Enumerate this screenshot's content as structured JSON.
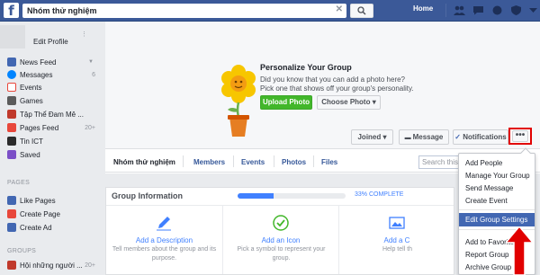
{
  "topbar": {
    "search_value": "Nhóm thử nghiệm",
    "home_label": "Home"
  },
  "sidebar": {
    "edit_profile": "Edit Profile",
    "items": [
      {
        "label": "News Feed",
        "count": "",
        "icon": "news-feed-icon",
        "color": "#4267b2"
      },
      {
        "label": "Messages",
        "count": "6",
        "icon": "messages-icon",
        "color": "#0084ff"
      },
      {
        "label": "Events",
        "count": "",
        "icon": "events-icon",
        "color": "#e8473b"
      },
      {
        "label": "Games",
        "count": "",
        "icon": "games-icon",
        "color": "#5b5b5b"
      },
      {
        "label": "Tập Thể Đam Mê ...",
        "count": "",
        "icon": "group-icon",
        "color": "#c0392b"
      },
      {
        "label": "Pages Feed",
        "count": "20+",
        "icon": "pages-feed-icon",
        "color": "#e8473b"
      },
      {
        "label": "Tin ICT",
        "count": "",
        "icon": "tin-ict-icon",
        "color": "#2b2b2b"
      },
      {
        "label": "Saved",
        "count": "",
        "icon": "saved-icon",
        "color": "#7b4fc7"
      }
    ],
    "pages_header": "PAGES",
    "pages_items": [
      {
        "label": "Like Pages",
        "icon": "like-pages-icon",
        "color": "#4267b2"
      },
      {
        "label": "Create Page",
        "icon": "create-page-icon",
        "color": "#e8473b"
      },
      {
        "label": "Create Ad",
        "icon": "create-ad-icon",
        "color": "#4267b2"
      }
    ],
    "groups_header": "GROUPS",
    "groups_items": [
      {
        "label": "Hội những người ...",
        "count": "20+",
        "icon": "group-item-icon",
        "color": "#c0392b"
      }
    ]
  },
  "cover": {
    "title": "Personalize Your Group",
    "line1": "Did you know that you can add a photo here?",
    "line2": "Pick one that shows off your group's personality.",
    "upload_label": "Upload Photo",
    "choose_label": "Choose Photo ▾"
  },
  "actions": {
    "joined_label": "Joined ▾",
    "message_label": "Message",
    "notifications_label": "Notifications",
    "more_label": "•••"
  },
  "tabs": {
    "group_name": "Nhóm thử nghiệm",
    "items": [
      "Members",
      "Events",
      "Photos",
      "Files"
    ],
    "search_placeholder": "Search this"
  },
  "group_info": {
    "title": "Group Information",
    "progress_fraction": 0.33,
    "progress_label": "33% COMPLETE",
    "columns": [
      {
        "link": "Add a Description",
        "desc": "Tell members about the group and its purpose."
      },
      {
        "link": "Add an Icon",
        "desc": "Pick a symbol to represent your group."
      },
      {
        "link": "Add a C",
        "desc": "Help tell th"
      }
    ]
  },
  "dropdown": {
    "items": [
      "Add People",
      "Manage Your Group",
      "Send Message",
      "Create Event",
      "Edit Group Settings",
      "Add to Favorites",
      "Report Group",
      "Archive Group"
    ],
    "highlighted": "Edit Group Settings"
  },
  "colors": {
    "brand": "#3b5998",
    "highlight": "#4267b2",
    "annotation_red": "#e10000"
  }
}
